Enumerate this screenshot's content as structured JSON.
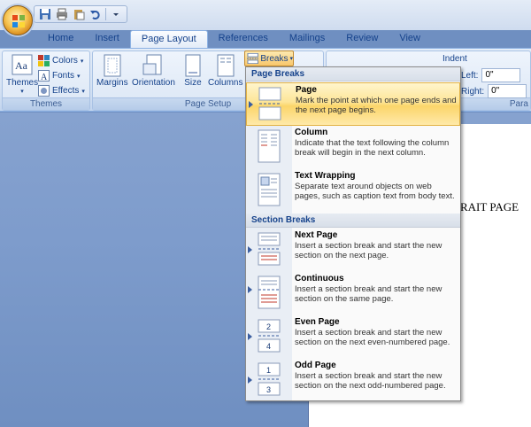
{
  "ribbon": {
    "tabs": [
      "Home",
      "Insert",
      "Page Layout",
      "References",
      "Mailings",
      "Review",
      "View"
    ],
    "active_tab": "Page Layout",
    "themes_group": {
      "label": "Themes",
      "themes_button": "Themes",
      "colors": "Colors",
      "fonts": "Fonts",
      "effects": "Effects"
    },
    "page_setup_group": {
      "label": "Page Setup",
      "margins": "Margins",
      "orientation": "Orientation",
      "size": "Size",
      "columns": "Columns",
      "breaks": "Breaks"
    },
    "paragraph_group": {
      "label": "Para",
      "indent": "Indent",
      "left_label": "Left:",
      "left_value": "0\"",
      "right_label": "Right:",
      "right_value": "0\""
    }
  },
  "document": {
    "visible_text": "RAIT PAGE"
  },
  "breaks_menu": {
    "page_breaks_header": "Page Breaks",
    "section_breaks_header": "Section Breaks",
    "items": [
      {
        "title": "Page",
        "desc": "Mark the point at which one page ends and the next page begins."
      },
      {
        "title": "Column",
        "desc": "Indicate that the text following the column break will begin in the next column."
      },
      {
        "title": "Text Wrapping",
        "desc": "Separate text around objects on web pages, such as caption text from body text."
      },
      {
        "title": "Next Page",
        "desc": "Insert a section break and start the new section on the next page."
      },
      {
        "title": "Continuous",
        "desc": "Insert a section break and start the new section on the same page."
      },
      {
        "title": "Even Page",
        "desc": "Insert a section break and start the new section on the next even-numbered page."
      },
      {
        "title": "Odd Page",
        "desc": "Insert a section break and start the new section on the next odd-numbered page."
      }
    ]
  },
  "icons": {
    "even_page_number": "2",
    "even_page_number_next": "4",
    "odd_page_number": "1",
    "odd_page_number_next": "3"
  },
  "colors": {
    "accent": "#15428b",
    "selection": "#fbd56a",
    "ribbon": "#d6e3f4",
    "background": "#7e9ccc"
  }
}
